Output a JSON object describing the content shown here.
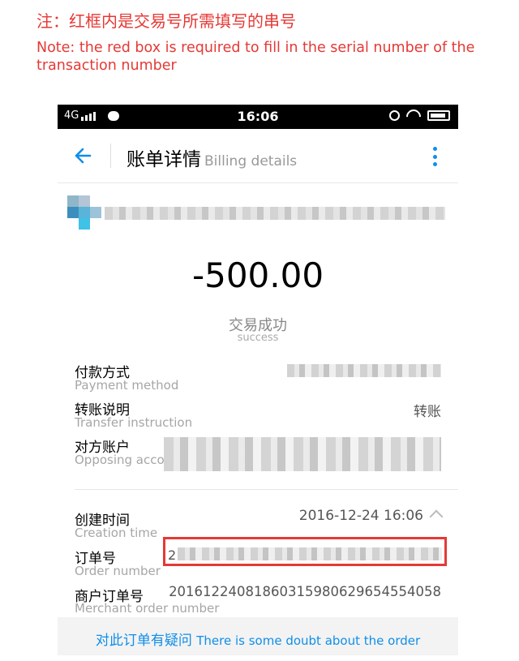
{
  "note": {
    "cn": "注：红框内是交易号所需填写的串号",
    "en": "Note: the red box is required to fill in the serial number of the transaction number"
  },
  "status_bar": {
    "network": "4G",
    "time": "16:06"
  },
  "appbar": {
    "title": "账单详情",
    "subtitle": "Billing details"
  },
  "transaction": {
    "amount": "-500.00",
    "status_cn": "交易成功",
    "status_en": "success"
  },
  "details": [
    {
      "label_cn": "付款方式",
      "label_en": "Payment method",
      "value": ""
    },
    {
      "label_cn": "转账说明",
      "label_en": "Transfer instruction",
      "value": "转账"
    },
    {
      "label_cn": "对方账户",
      "label_en": "Opposing account",
      "value": ""
    },
    {
      "label_cn": "创建时间",
      "label_en": "Creation time",
      "value": "2016-12-24 16:06"
    },
    {
      "label_cn": "订单号",
      "label_en": "Order number",
      "value": "2"
    },
    {
      "label_cn": "商户订单号",
      "label_en": "Merchant order number",
      "value": "20161224081860315980629654554058"
    }
  ],
  "footer": {
    "doubt_cn": "对此订单有疑问",
    "doubt_en": "There is some doubt about the order"
  },
  "colors": {
    "accent": "#108ee9",
    "annotation_red": "#e53935"
  }
}
